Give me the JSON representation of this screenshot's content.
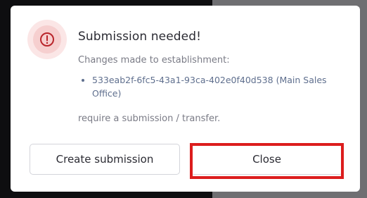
{
  "dialog": {
    "icon": "alert-circle-icon",
    "title": "Submission needed!",
    "subtitle": "Changes made to establishment:",
    "items": [
      "533eab2f-6fc5-43a1-93ca-402e0f40d538 (Main Sales Office)"
    ],
    "note": "require a submission / transfer.",
    "buttons": {
      "create_label": "Create submission",
      "close_label": "Close"
    }
  },
  "colors": {
    "alert_red": "#b9252b",
    "highlight_red": "#dc1d1d",
    "item_text": "#5f6f8e"
  }
}
